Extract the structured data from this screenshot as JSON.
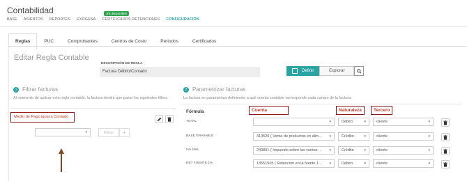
{
  "app": {
    "title": "Contabilidad"
  },
  "nav": {
    "items": [
      "BASE",
      "ASIENTOS",
      "REPORTES",
      "EXÓGENA",
      "CERTIFICADOS RETENCIONES",
      "CONFIGURACIÓN"
    ],
    "badge": "¡Ya disponible!"
  },
  "tabs": [
    "Reglas",
    "PUC",
    "Comprobantes",
    "Centros de Costo",
    "Periodos",
    "Certificados"
  ],
  "page": {
    "heading": "Editar Regla Contable"
  },
  "description": {
    "label": "DESCRIPCIÓN DE REGLA",
    "value": "Factura Débito/Contado"
  },
  "mode": {
    "define": "Definir",
    "explore": "Explorar"
  },
  "filter_section": {
    "number": "1",
    "title": "Filtrar facturas",
    "subtitle": "Al momento de aplicar esta regla contable, la factura tendrá que pasar los siguientes filtros.",
    "filter_label": "Medio de Pago igual a Contado",
    "filtrar_label": "Filtrar",
    "plus": "+"
  },
  "param_section": {
    "number": "2",
    "title": "Parametrizar facturas",
    "subtitle": "La factura se parametriza definiendo a qué cuenta contable corresponde cada campo de la factura."
  },
  "table": {
    "headers": {
      "formula": "Fórmula",
      "cuenta": "Cuenta",
      "naturaleza": "Naturaleza",
      "tercero": "Tercero"
    },
    "rows": [
      {
        "label": "TOTAL",
        "cuenta": "",
        "naturaleza": "Débito",
        "tercero": "cliente"
      },
      {
        "label": "BASE GRAVABLE",
        "cuenta": "413520 ( Venta de productos en alm...",
        "naturaleza": "Crédito",
        "tercero": "cliente"
      },
      {
        "label": "IVA 19%",
        "cuenta": "240801 ( Impuesto sobre las ventas ...",
        "naturaleza": "Crédito",
        "tercero": "cliente"
      },
      {
        "label": "RET FUENTE 1%",
        "cuenta": "13551505 ( Retención en la fuente 1...",
        "naturaleza": "Débito",
        "tercero": "cliente"
      }
    ]
  },
  "colors": {
    "accent": "#2aa3a3",
    "highlight_border": "#8b1a1a",
    "highlight_text": "#c0392b",
    "badge": "#2ea44f"
  }
}
